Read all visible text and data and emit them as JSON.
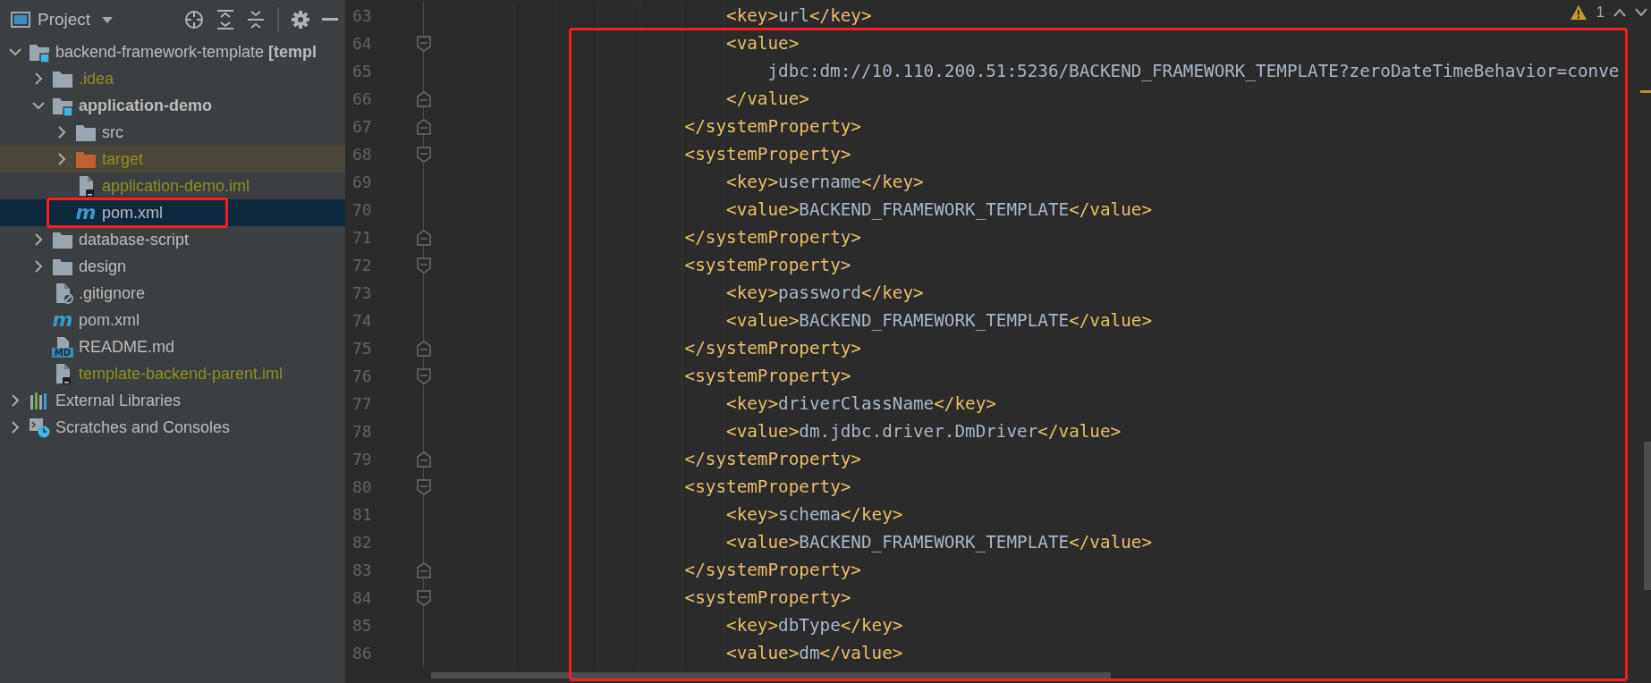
{
  "project_panel": {
    "title": "Project",
    "tree": [
      {
        "label": "backend-framework-template **[templ**",
        "kind": "module",
        "bold": false,
        "expanded": true,
        "selected": false,
        "ignored": false,
        "children": [
          {
            "label": ".idea",
            "kind": "folder",
            "bold": false,
            "expanded": false,
            "selected": false,
            "ignored": true
          },
          {
            "label": "application-demo",
            "kind": "module",
            "bold": true,
            "expanded": true,
            "selected": false,
            "ignored": false,
            "children": [
              {
                "label": "src",
                "kind": "folder",
                "bold": false,
                "expanded": false,
                "selected": false,
                "ignored": false
              },
              {
                "label": "target",
                "kind": "excluded-folder",
                "bold": false,
                "expanded": false,
                "selected": false,
                "ignored": true
              },
              {
                "label": "application-demo.iml",
                "kind": "iml",
                "bold": false,
                "selected": false,
                "ignored": true
              },
              {
                "label": "pom.xml",
                "kind": "maven",
                "icon_text": "m",
                "bold": false,
                "selected": true,
                "ignored": false
              }
            ]
          },
          {
            "label": "database-script",
            "kind": "folder",
            "bold": false,
            "expanded": false,
            "selected": false,
            "ignored": false
          },
          {
            "label": "design",
            "kind": "folder",
            "bold": false,
            "expanded": false,
            "selected": false,
            "ignored": false
          },
          {
            "label": ".gitignore",
            "kind": "gitignore",
            "bold": false,
            "selected": false,
            "ignored": false
          },
          {
            "label": "pom.xml",
            "kind": "maven",
            "icon_text": "m",
            "bold": false,
            "selected": false,
            "ignored": false
          },
          {
            "label": "README.md",
            "kind": "markdown",
            "icon_text": "MD",
            "bold": false,
            "selected": false,
            "ignored": false
          },
          {
            "label": "template-backend-parent.iml",
            "kind": "iml",
            "bold": false,
            "selected": false,
            "ignored": true
          }
        ]
      },
      {
        "label": "External Libraries",
        "kind": "libraries",
        "bold": false,
        "expanded": false,
        "selected": false,
        "ignored": false
      },
      {
        "label": "Scratches and Consoles",
        "kind": "scratches",
        "bold": false,
        "expanded": false,
        "selected": false,
        "ignored": false
      }
    ]
  },
  "editor": {
    "inspection": {
      "count": "1"
    },
    "lines": [
      {
        "number": "63",
        "fold_start": false,
        "fold_end": false,
        "text": "                            <key>url</key>"
      },
      {
        "number": "64",
        "fold_start": true,
        "fold_end": false,
        "text": "                            <value>"
      },
      {
        "number": "65",
        "fold_start": false,
        "fold_end": false,
        "text": "                                jdbc:dm://10.110.200.51:5236/BACKEND_FRAMEWORK_TEMPLATE?zeroDateTimeBehavior=conve"
      },
      {
        "number": "66",
        "fold_start": false,
        "fold_end": true,
        "text": "                            </value>"
      },
      {
        "number": "67",
        "fold_start": false,
        "fold_end": true,
        "text": "                        </systemProperty>"
      },
      {
        "number": "68",
        "fold_start": true,
        "fold_end": false,
        "text": "                        <systemProperty>"
      },
      {
        "number": "69",
        "fold_start": false,
        "fold_end": false,
        "text": "                            <key>username</key>"
      },
      {
        "number": "70",
        "fold_start": false,
        "fold_end": false,
        "text": "                            <value>BACKEND_FRAMEWORK_TEMPLATE</value>"
      },
      {
        "number": "71",
        "fold_start": false,
        "fold_end": true,
        "text": "                        </systemProperty>"
      },
      {
        "number": "72",
        "fold_start": true,
        "fold_end": false,
        "text": "                        <systemProperty>"
      },
      {
        "number": "73",
        "fold_start": false,
        "fold_end": false,
        "text": "                            <key>password</key>"
      },
      {
        "number": "74",
        "fold_start": false,
        "fold_end": false,
        "text": "                            <value>BACKEND_FRAMEWORK_TEMPLATE</value>"
      },
      {
        "number": "75",
        "fold_start": false,
        "fold_end": true,
        "text": "                        </systemProperty>"
      },
      {
        "number": "76",
        "fold_start": true,
        "fold_end": false,
        "text": "                        <systemProperty>"
      },
      {
        "number": "77",
        "fold_start": false,
        "fold_end": false,
        "text": "                            <key>driverClassName</key>"
      },
      {
        "number": "78",
        "fold_start": false,
        "fold_end": false,
        "text": "                            <value>dm.jdbc.driver.DmDriver</value>"
      },
      {
        "number": "79",
        "fold_start": false,
        "fold_end": true,
        "text": "                        </systemProperty>"
      },
      {
        "number": "80",
        "fold_start": true,
        "fold_end": false,
        "text": "                        <systemProperty>"
      },
      {
        "number": "81",
        "fold_start": false,
        "fold_end": false,
        "text": "                            <key>schema</key>"
      },
      {
        "number": "82",
        "fold_start": false,
        "fold_end": false,
        "text": "                            <value>BACKEND_FRAMEWORK_TEMPLATE</value>"
      },
      {
        "number": "83",
        "fold_start": false,
        "fold_end": true,
        "text": "                        </systemProperty>"
      },
      {
        "number": "84",
        "fold_start": true,
        "fold_end": false,
        "text": "                        <systemProperty>"
      },
      {
        "number": "85",
        "fold_start": false,
        "fold_end": false,
        "text": "                            <key>dbType</key>"
      },
      {
        "number": "86",
        "fold_start": false,
        "fold_end": false,
        "text": "                            <value>dm</value>"
      }
    ]
  }
}
